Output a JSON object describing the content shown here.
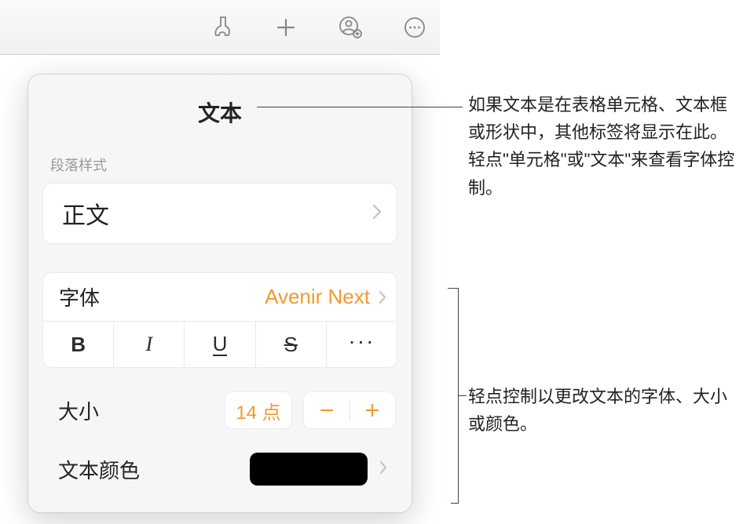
{
  "toolbar": {
    "icons": {
      "format": "format-brush-icon",
      "insert": "plus-icon",
      "collaborate": "collaborate-icon",
      "more": "more-icon"
    }
  },
  "popover": {
    "title": "文本",
    "paragraph_style_label": "段落样式",
    "paragraph_style_value": "正文",
    "font": {
      "label": "字体",
      "value": "Avenir Next"
    },
    "style_buttons": {
      "bold": "B",
      "italic": "I",
      "underline": "U",
      "strike": "S",
      "more": "···"
    },
    "size": {
      "label": "大小",
      "value": "14 点"
    },
    "text_color": {
      "label": "文本颜色",
      "swatch_hex": "#000000"
    }
  },
  "callouts": {
    "a": "如果文本是在表格单元格、文本框或形状中，其他标签将显示在此。轻点\"单元格\"或\"文本\"来查看字体控制。",
    "b": "轻点控制以更改文本的字体、大小或颜色。"
  }
}
